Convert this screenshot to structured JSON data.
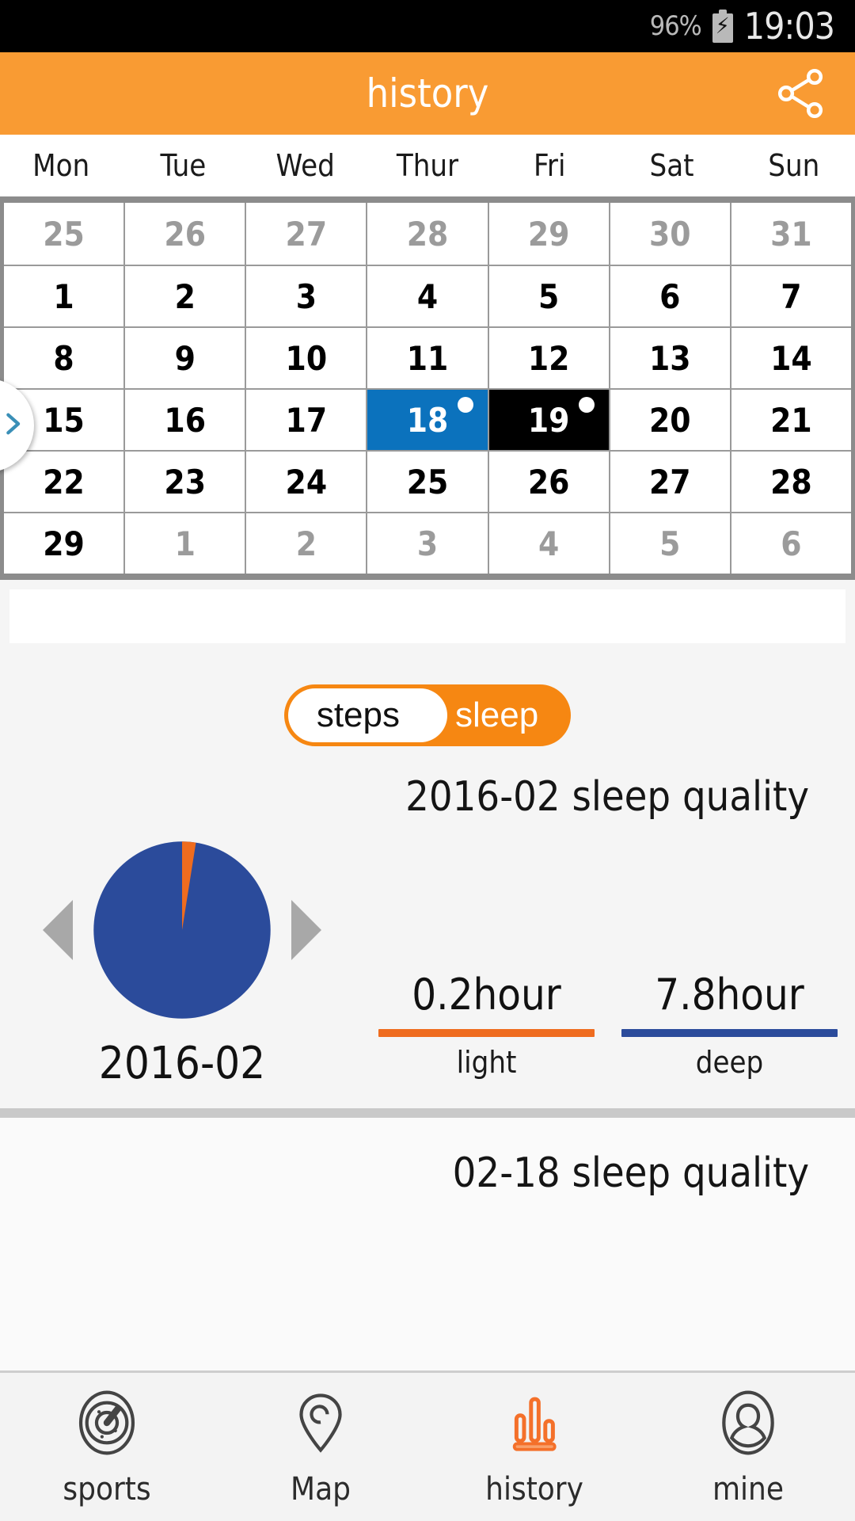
{
  "status_bar": {
    "battery_percent": "96%",
    "battery_icon": "battery-charging-icon",
    "time": "19:03"
  },
  "header": {
    "title": "history",
    "share_icon": "share-icon"
  },
  "calendar": {
    "weekdays": [
      "Mon",
      "Tue",
      "Wed",
      "Thur",
      "Fri",
      "Sat",
      "Sun"
    ],
    "rows": [
      [
        {
          "day": "25",
          "state": "muted"
        },
        {
          "day": "26",
          "state": "muted"
        },
        {
          "day": "27",
          "state": "muted"
        },
        {
          "day": "28",
          "state": "muted"
        },
        {
          "day": "29",
          "state": "muted"
        },
        {
          "day": "30",
          "state": "muted"
        },
        {
          "day": "31",
          "state": "muted"
        }
      ],
      [
        {
          "day": "1",
          "state": "normal"
        },
        {
          "day": "2",
          "state": "normal"
        },
        {
          "day": "3",
          "state": "normal"
        },
        {
          "day": "4",
          "state": "normal"
        },
        {
          "day": "5",
          "state": "normal"
        },
        {
          "day": "6",
          "state": "normal"
        },
        {
          "day": "7",
          "state": "normal"
        }
      ],
      [
        {
          "day": "8",
          "state": "normal"
        },
        {
          "day": "9",
          "state": "normal"
        },
        {
          "day": "10",
          "state": "normal"
        },
        {
          "day": "11",
          "state": "normal"
        },
        {
          "day": "12",
          "state": "normal"
        },
        {
          "day": "13",
          "state": "normal"
        },
        {
          "day": "14",
          "state": "normal"
        }
      ],
      [
        {
          "day": "15",
          "state": "normal"
        },
        {
          "day": "16",
          "state": "normal"
        },
        {
          "day": "17",
          "state": "normal"
        },
        {
          "day": "18",
          "state": "selected-blue",
          "dot": true
        },
        {
          "day": "19",
          "state": "selected-black",
          "dot": true
        },
        {
          "day": "20",
          "state": "normal"
        },
        {
          "day": "21",
          "state": "normal"
        }
      ],
      [
        {
          "day": "22",
          "state": "normal"
        },
        {
          "day": "23",
          "state": "normal"
        },
        {
          "day": "24",
          "state": "normal"
        },
        {
          "day": "25",
          "state": "normal"
        },
        {
          "day": "26",
          "state": "normal"
        },
        {
          "day": "27",
          "state": "normal"
        },
        {
          "day": "28",
          "state": "normal"
        }
      ],
      [
        {
          "day": "29",
          "state": "normal"
        },
        {
          "day": "1",
          "state": "muted"
        },
        {
          "day": "2",
          "state": "muted"
        },
        {
          "day": "3",
          "state": "muted"
        },
        {
          "day": "4",
          "state": "muted"
        },
        {
          "day": "5",
          "state": "muted"
        },
        {
          "day": "6",
          "state": "muted"
        }
      ]
    ],
    "drawer_handle_icon": "chevron-right-icon"
  },
  "toggle": {
    "steps_label": "steps",
    "sleep_label": "sleep",
    "selected": "sleep"
  },
  "month_section": {
    "title": "2016-02 sleep quality",
    "pie_label": "2016-02",
    "prev_icon": "triangle-left-icon",
    "next_icon": "triangle-right-icon",
    "stats": [
      {
        "value": "0.2hour",
        "label": "light",
        "color": "#ef6c1f"
      },
      {
        "value": "7.8hour",
        "label": "deep",
        "color": "#2b4b9b"
      }
    ]
  },
  "day_section": {
    "title": "02-18 sleep quality"
  },
  "bottom_nav": {
    "items": [
      {
        "label": "sports",
        "icon": "compass-icon",
        "active": false
      },
      {
        "label": "Map",
        "icon": "map-pin-icon",
        "active": false
      },
      {
        "label": "history",
        "icon": "bar-chart-icon",
        "active": true
      },
      {
        "label": "mine",
        "icon": "person-icon",
        "active": false
      }
    ]
  },
  "colors": {
    "accent_orange": "#f68712",
    "header_orange": "#f99b33",
    "selected_blue": "#0b72bd",
    "light_sleep": "#ef6c1f",
    "deep_sleep": "#2b4b9b"
  },
  "chart_data": {
    "type": "pie",
    "title": "2016-02 sleep quality",
    "labels": [
      "light",
      "deep"
    ],
    "values": [
      0.2,
      7.8
    ],
    "units": "hour",
    "colors": [
      "#ef6c1f",
      "#2b4b9b"
    ],
    "legend": "below",
    "total": 8.0,
    "percentages": [
      2.5,
      97.5
    ]
  }
}
